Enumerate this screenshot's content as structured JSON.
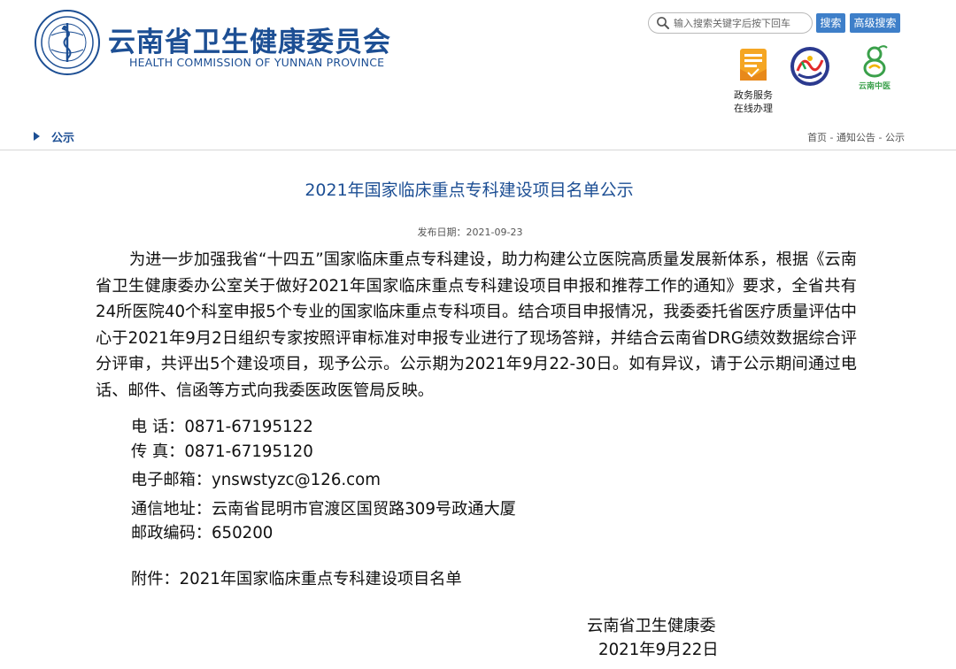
{
  "header": {
    "site_title": "云南省卫生健康委员会",
    "site_subtitle": "HEALTH COMMISSION OF YUNNAN PROVINCE",
    "search_placeholder": "输入搜索关键字后按下回车",
    "search_button": "搜索",
    "advanced_search_button": "高级搜索",
    "service_label_line1": "政务服务",
    "service_label_line2": "在线办理",
    "logo3_text": "云南中医"
  },
  "nav": {
    "section_title": "公示",
    "breadcrumb": [
      "首页",
      "通知公告",
      "公示"
    ],
    "breadcrumb_sep": " - "
  },
  "article": {
    "title": "2021年国家临床重点专科建设项目名单公示",
    "publish_date": "发布日期：2021-09-23",
    "paragraph": "为进一步加强我省“十四五”国家临床重点专科建设，助力构建公立医院高质量发展新体系，根据《云南省卫生健康委办公室关于做好2021年国家临床重点专科建设项目申报和推荐工作的通知》要求，全省共有24所医院40个科室申报5个专业的国家临床重点专科项目。结合项目申报情况，我委委托省医疗质量评估中心于2021年9月2日组织专家按照评审标准对申报专业进行了现场答辩，并结合云南省DRG绩效数据综合评分评审，共评出5个建设项目，现予公示。公示期为2021年9月22-30日。如有异议，请于公示期间通过电话、邮件、信函等方式向我委医政医管局反映。",
    "phone": "电 话：0871-67195122",
    "fax": "传 真：0871-67195120",
    "email": "电子邮箱：ynswstyzc@126.com",
    "address": "通信地址：云南省昆明市官渡区国贸路309号政通大厦",
    "postcode": "邮政编码：650200",
    "attachment": "附件：2021年国家临床重点专科建设项目名单",
    "signer": "云南省卫生健康委",
    "sign_date": "2021年9月22日"
  },
  "colors": {
    "brand_blue": "#1d4f94",
    "button_blue": "#3e7fc9"
  }
}
